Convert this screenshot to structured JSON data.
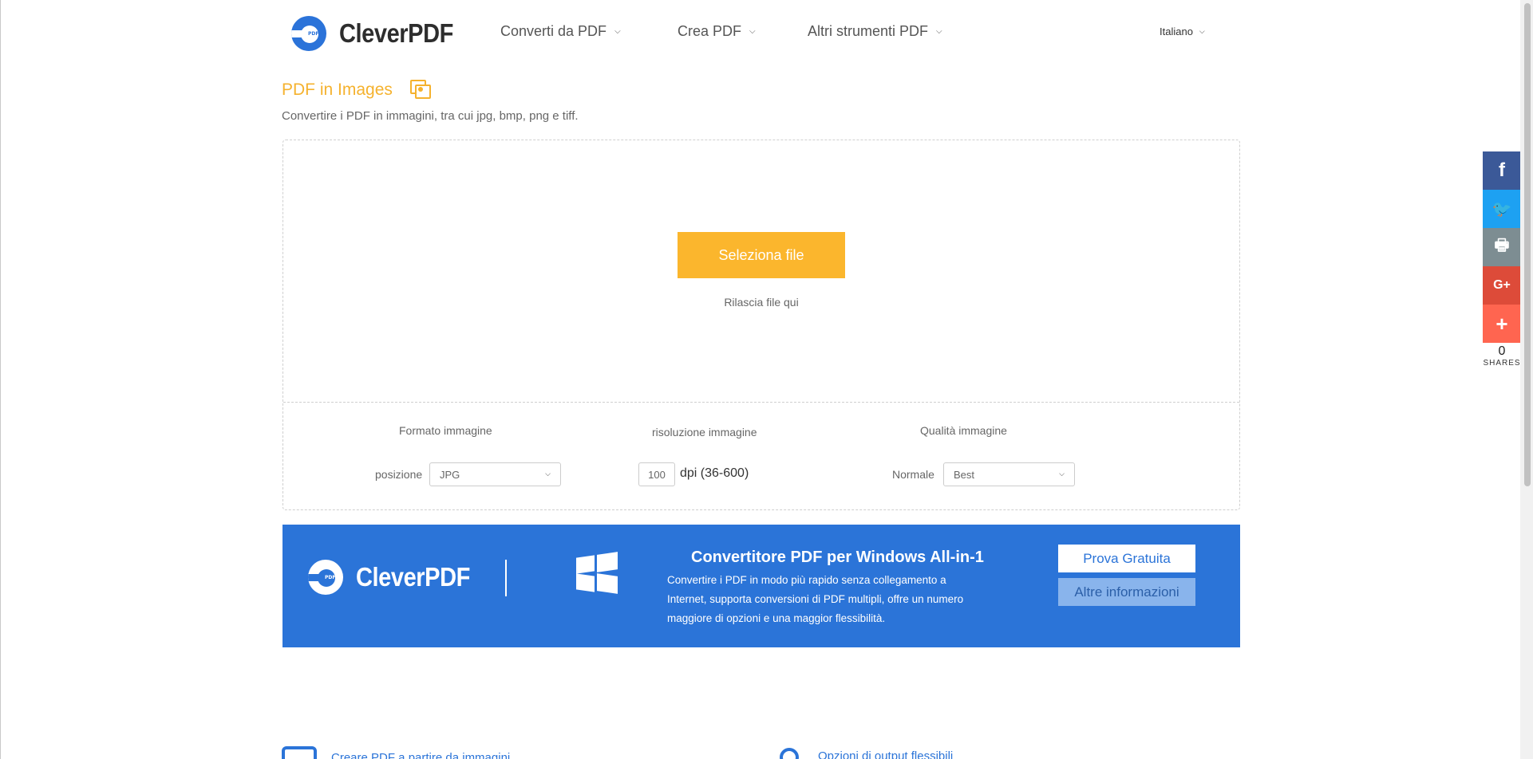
{
  "brand": {
    "name": "CleverPDF",
    "logo_tag": "PDF",
    "primary_color": "#2b73d9",
    "accent_color": "#fbb62d"
  },
  "nav": {
    "items": [
      {
        "label": "Converti da PDF"
      },
      {
        "label": "Crea PDF"
      },
      {
        "label": "Altri strumenti PDF"
      }
    ],
    "language": "Italiano"
  },
  "tool": {
    "title": "PDF in Images",
    "subtitle": "Convertire i PDF in immagini, tra cui jpg, bmp, png e tiff."
  },
  "upload": {
    "button_label": "Seleziona file",
    "drop_hint": "Rilascia file qui"
  },
  "options": {
    "format": {
      "heading": "Formato immagine",
      "label": "posizione",
      "value": "JPG"
    },
    "resolution": {
      "heading": "risoluzione immagine",
      "value": "100",
      "unit": "dpi (36-600)"
    },
    "quality": {
      "heading": "Qualità immagine",
      "label": "Normale",
      "value": "Best"
    }
  },
  "promo": {
    "title": "Convertitore PDF per Windows All-in-1",
    "description": "Convertire i PDF in modo più rapido senza collegamento a Internet, supporta conversioni di PDF multipli, offre un numero maggiore di opzioni e una maggior flessibilità.",
    "try_label": "Prova Gratuita",
    "more_label": "Altre informazioni",
    "background": "#2b74d8"
  },
  "features": [
    {
      "label": "Creare PDF a partire da immagini",
      "icon": "image-icon"
    },
    {
      "label": "Opzioni di output flessibili",
      "icon": "options-icon"
    }
  ],
  "share": {
    "buttons": [
      {
        "icon": "facebook-icon",
        "glyph": "f",
        "color": "#3b5998"
      },
      {
        "icon": "twitter-icon",
        "glyph": "🐦",
        "color": "#1da1f2"
      },
      {
        "icon": "print-icon",
        "glyph": "🖶",
        "color": "#7d8d92"
      },
      {
        "icon": "google-plus-icon",
        "glyph": "G+",
        "color": "#dd4b39"
      },
      {
        "icon": "more-icon",
        "glyph": "+",
        "color": "#ff6550"
      }
    ],
    "count": "0",
    "label": "SHARES"
  }
}
